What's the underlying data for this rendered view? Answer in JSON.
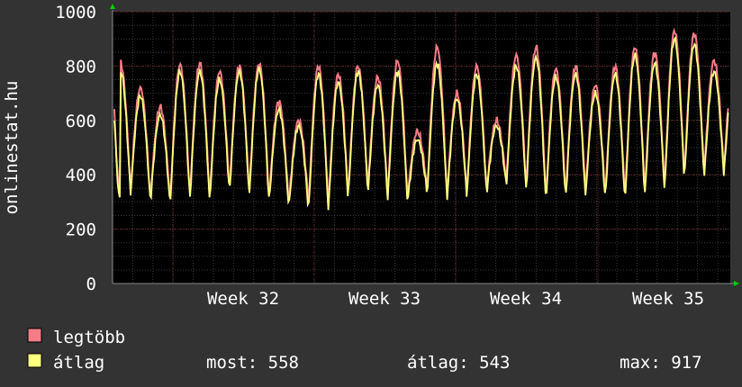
{
  "chart_data": {
    "type": "line",
    "ylabel": "onlinestat.hu",
    "ylim": [
      0,
      1000
    ],
    "yticks": [
      0,
      200,
      400,
      600,
      800,
      1000
    ],
    "xtick_labels": [
      "Week 32",
      "Week 33",
      "Week 34",
      "Week 35"
    ],
    "grid": true,
    "colors": {
      "background": "#333333",
      "plot": "#000000",
      "legtobb": "#f47c86",
      "atlag": "#ffff80",
      "arrow": "#00cc00"
    },
    "series": [
      {
        "name": "legtöbb",
        "color": "#f47c86",
        "peaks": [
          810,
          720,
          650,
          805,
          810,
          780,
          800,
          810,
          670,
          600,
          800,
          770,
          800,
          760,
          820,
          560,
          870,
          700,
          800,
          600,
          840,
          870,
          790,
          800,
          730,
          800,
          870,
          850,
          930,
          920,
          820
        ],
        "troughs": [
          330,
          350,
          320,
          310,
          330,
          320,
          350,
          340,
          320,
          300,
          300,
          290,
          330,
          350,
          330,
          320,
          350,
          330,
          340,
          350,
          380,
          360,
          320,
          330,
          340,
          330,
          320,
          340,
          360,
          400,
          410,
          420
        ]
      },
      {
        "name": "átlag",
        "color": "#ffff80",
        "peaks": [
          780,
          690,
          620,
          780,
          780,
          750,
          780,
          790,
          640,
          580,
          770,
          740,
          780,
          730,
          780,
          530,
          810,
          680,
          770,
          580,
          800,
          830,
          760,
          770,
          700,
          770,
          840,
          810,
          900,
          880,
          780
        ],
        "troughs": [
          310,
          330,
          300,
          290,
          310,
          300,
          330,
          320,
          300,
          280,
          270,
          270,
          310,
          330,
          310,
          300,
          330,
          310,
          320,
          330,
          360,
          340,
          300,
          310,
          320,
          310,
          300,
          320,
          340,
          380,
          390,
          400
        ]
      }
    ]
  },
  "legend": [
    {
      "label": "legtöbb",
      "color": "#f47c86"
    },
    {
      "label": "átlag",
      "color": "#ffff80"
    }
  ],
  "stats": {
    "most": "most: 558",
    "atlag": "átlag: 543",
    "max": "max: 917"
  }
}
